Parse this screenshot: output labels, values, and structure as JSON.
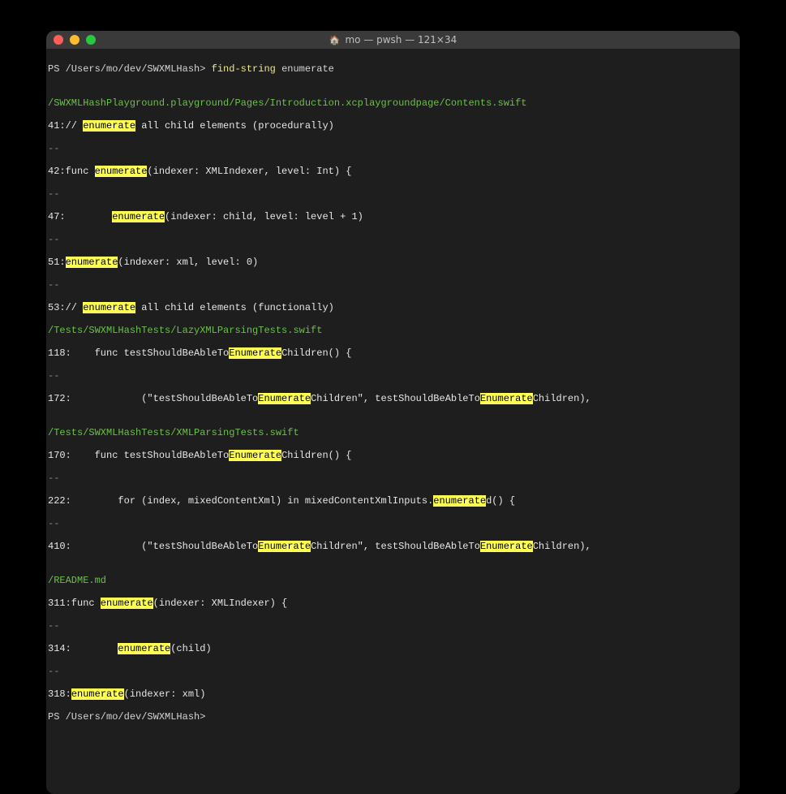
{
  "window": {
    "title": "mo — pwsh — 121×34"
  },
  "prompt": {
    "ps": "PS /Users/mo/dev/SWXMLHash>",
    "command": "find-string",
    "arg": "enumerate"
  },
  "files": {
    "f1": "/SWXMLHashPlayground.playground/Pages/Introduction.xcplaygroundpage/Contents.swift",
    "f2": "/Tests/SWXMLHashTests/LazyXMLParsingTests.swift",
    "f3": "/Tests/SWXMLHashTests/XMLParsingTests.swift",
    "f4": "/README.md"
  },
  "lines": {
    "l41a": "41:// ",
    "l41b": " all child elements (procedurally)",
    "l42a": "42:func ",
    "l42b": "(indexer: XMLIndexer, level: Int) {",
    "l47a": "47:        ",
    "l47b": "(indexer: child, level: level + 1)",
    "l51a": "51:",
    "l51b": "(indexer: xml, level: 0)",
    "l53a": "53:// ",
    "l53b": " all child elements (functionally)",
    "l118a": "118:    func testShouldBeAbleTo",
    "l118b": "Children() {",
    "l172a": "172:            (\"testShouldBeAbleTo",
    "l172b": "Children\", testShouldBeAbleTo",
    "l172c": "Children),",
    "l170a": "170:    func testShouldBeAbleTo",
    "l170b": "Children() {",
    "l222a": "222:        for (index, mixedContentXml) in mixedContentXmlInputs.",
    "l222b": "d() {",
    "l410a": "410:            (\"testShouldBeAbleTo",
    "l410b": "Children\", testShouldBeAbleTo",
    "l410c": "Children),",
    "l311a": "311:func ",
    "l311b": "(indexer: XMLIndexer) {",
    "l314a": "314:        ",
    "l314b": "(child)",
    "l318a": "318:",
    "l318b": "(indexer: xml)"
  },
  "hl": {
    "enumerate": "enumerate",
    "Enumerate": "Enumerate"
  },
  "sep": "--",
  "blank": ""
}
